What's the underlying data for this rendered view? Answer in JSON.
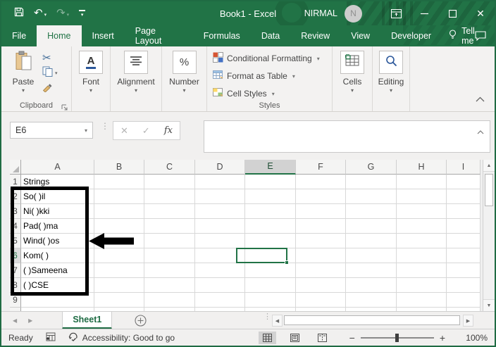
{
  "titlebar": {
    "title": "Book1 - Excel",
    "user": "NIRMAL",
    "avatar_initial": "N"
  },
  "tabs": {
    "items": [
      {
        "label": "File",
        "active": false
      },
      {
        "label": "Home",
        "active": true
      },
      {
        "label": "Insert",
        "active": false
      },
      {
        "label": "Page Layout",
        "active": false
      },
      {
        "label": "Formulas",
        "active": false
      },
      {
        "label": "Data",
        "active": false
      },
      {
        "label": "Review",
        "active": false
      },
      {
        "label": "View",
        "active": false
      },
      {
        "label": "Developer",
        "active": false
      }
    ],
    "tell_me": "Tell me"
  },
  "ribbon": {
    "paste_label": "Paste",
    "clipboard_group": "Clipboard",
    "font_label": "Font",
    "alignment_label": "Alignment",
    "number_label": "Number",
    "styles_items": [
      "Conditional Formatting",
      "Format as Table",
      "Cell Styles"
    ],
    "styles_group": "Styles",
    "cells_label": "Cells",
    "editing_label": "Editing"
  },
  "formula_bar": {
    "name_box": "E6",
    "fx_label": "fx",
    "content": ""
  },
  "grid": {
    "columns": [
      "A",
      "B",
      "C",
      "D",
      "E",
      "F",
      "G",
      "H",
      "I"
    ],
    "rows": [
      "1",
      "2",
      "3",
      "4",
      "5",
      "6",
      "7",
      "8",
      "9"
    ],
    "selected_column": "E",
    "selected_row": "6",
    "selected_cell": "E6",
    "column_a_values": [
      "Strings",
      "So( )il",
      "Ni( )kki",
      "Pad( )ma",
      "Wind( )os",
      "Kom( )",
      "( )Sameena",
      "( )CSE",
      ""
    ]
  },
  "sheet_bar": {
    "active_tab": "Sheet1"
  },
  "status_bar": {
    "mode": "Ready",
    "accessibility": "Accessibility: Good to go",
    "zoom_level": "100%"
  },
  "colors": {
    "accent_green": "#217346",
    "selection_green": "#217346",
    "annotation_black": "#000000"
  }
}
